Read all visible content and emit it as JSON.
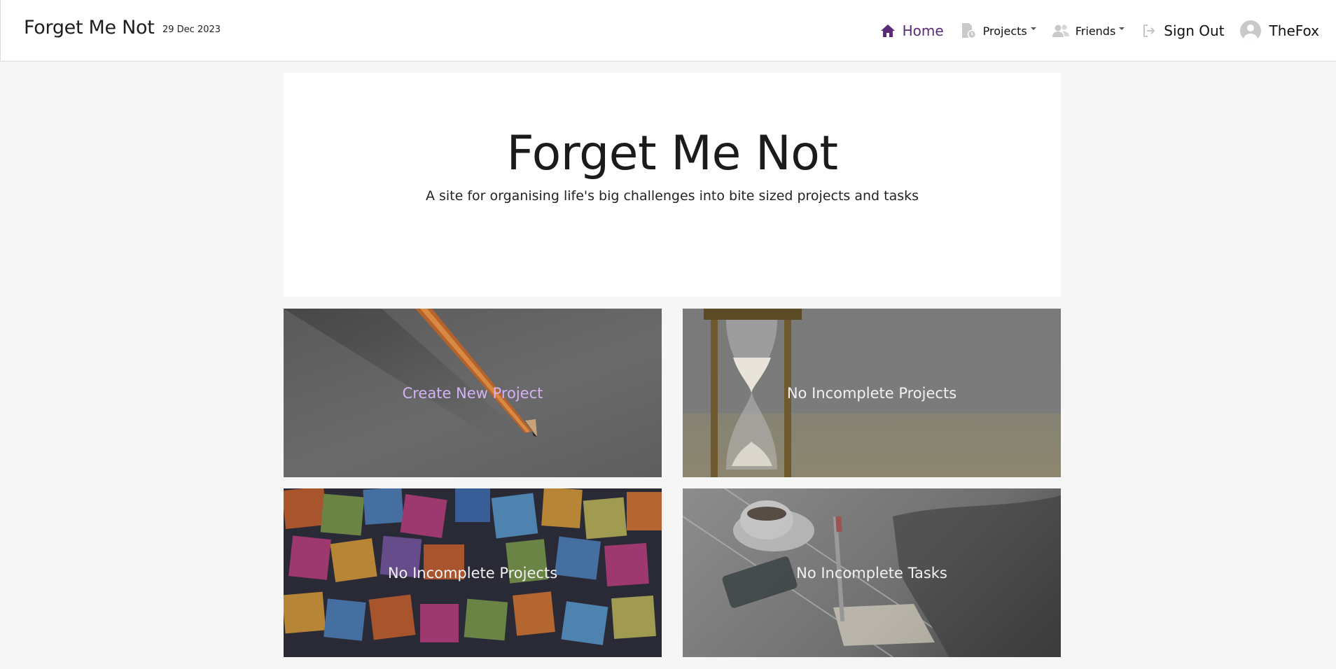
{
  "navbar": {
    "brand": "Forget Me Not",
    "date": "29 Dec 2023",
    "links": {
      "home": "Home",
      "projects": "Projects",
      "friends": "Friends",
      "sign_out": "Sign Out",
      "user": "TheFox"
    },
    "active_color": "#5b2a78"
  },
  "hero": {
    "title": "Forget Me Not",
    "subtitle": "A site for organising life's big challenges into bite sized projects and tasks"
  },
  "cards": [
    {
      "label": "Create New Project",
      "image": "pencil-paper-photo"
    },
    {
      "label": "No Incomplete Projects",
      "image": "hourglass-photo"
    },
    {
      "label": "No Incomplete Projects",
      "image": "sticky-notes-photo"
    },
    {
      "label": "No Incomplete Tasks",
      "image": "writing-notebook-photo"
    }
  ],
  "colors": {
    "accent": "#d5b2f5",
    "background": "#f6f6f6"
  }
}
